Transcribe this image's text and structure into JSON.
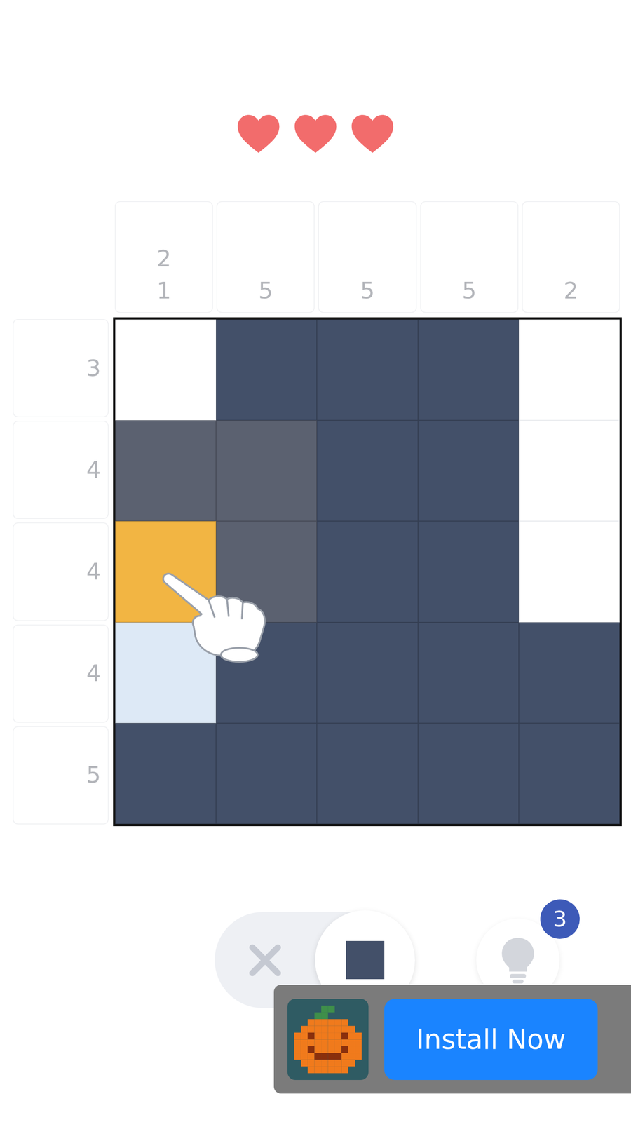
{
  "lives": {
    "hearts": [
      {
        "filled": true
      },
      {
        "filled": true
      },
      {
        "filled": true
      }
    ]
  },
  "columnClues": [
    [
      "2",
      "1"
    ],
    [
      "5"
    ],
    [
      "5"
    ],
    [
      "5"
    ],
    [
      "2"
    ]
  ],
  "rowClues": [
    "3",
    "4",
    "4",
    "4",
    "5"
  ],
  "grid": [
    [
      "empty",
      "filled",
      "filled",
      "filled",
      "empty"
    ],
    [
      "preview",
      "preview",
      "filled",
      "filled",
      "empty"
    ],
    [
      "cursor",
      "preview",
      "filled",
      "filled",
      "empty"
    ],
    [
      "highlight",
      "filled",
      "filled",
      "filled",
      "filled"
    ],
    [
      "filled",
      "filled",
      "filled",
      "filled",
      "filled"
    ]
  ],
  "tools": [
    {
      "kind": "cross",
      "selected": false
    },
    {
      "kind": "fill",
      "selected": true
    }
  ],
  "hint": {
    "count": "3"
  },
  "ad": {
    "button": "Install Now"
  }
}
